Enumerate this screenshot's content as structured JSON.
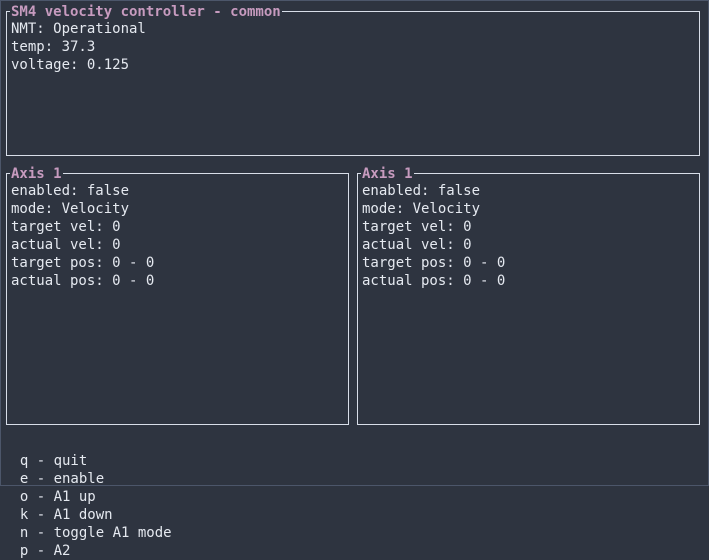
{
  "common": {
    "title": "SM4 velocity controller - common",
    "lines": [
      "NMT: Operational",
      "temp: 37.3",
      "voltage: 0.125"
    ]
  },
  "axes": [
    {
      "title": "Axis 1",
      "lines": [
        "enabled: false",
        "mode: Velocity",
        "target vel: 0",
        "actual vel: 0",
        "target pos: 0 - 0",
        "actual pos: 0 - 0"
      ]
    },
    {
      "title": "Axis 1",
      "lines": [
        "enabled: false",
        "mode: Velocity",
        "target vel: 0",
        "actual vel: 0",
        "target pos: 0 - 0",
        "actual pos: 0 - 0"
      ]
    }
  ],
  "footer": {
    "keys": [
      "q - quit",
      "e - enable",
      "o - A1 up",
      "k - A1 down",
      "n - toggle A1 mode",
      "p - A2"
    ]
  },
  "colors": {
    "background": "#2e3440",
    "text": "#e5e9f0",
    "title": "#c79bbf",
    "border": "#d8dee9"
  }
}
